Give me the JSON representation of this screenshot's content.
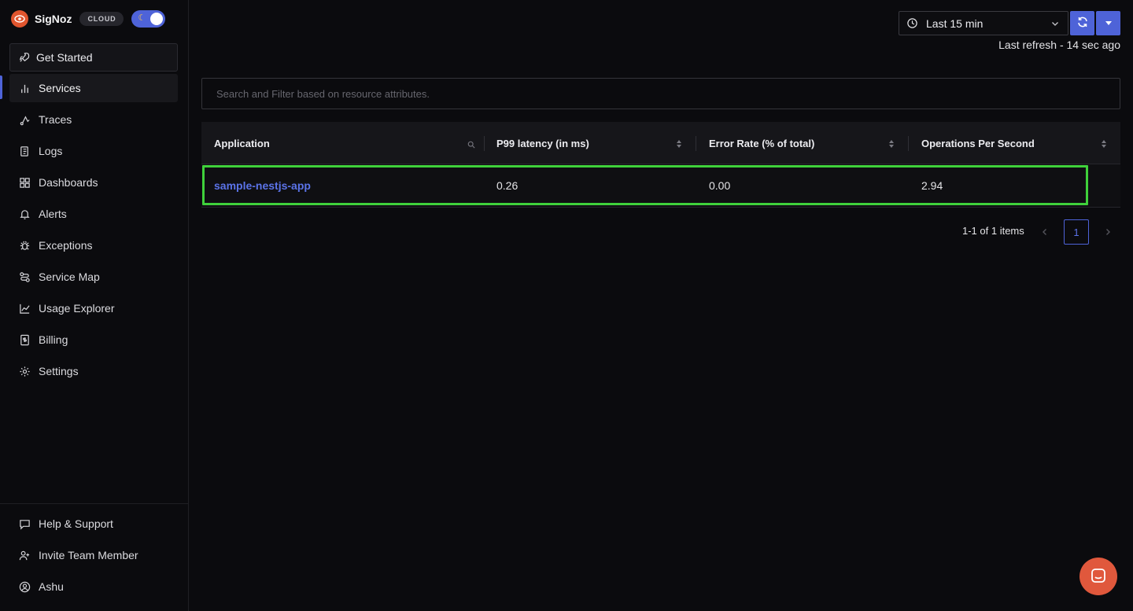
{
  "brand": {
    "name": "SigNoz",
    "badge": "CLOUD"
  },
  "sidebar": {
    "get_started": "Get Started",
    "items": [
      {
        "label": "Services",
        "icon": "bar-chart-icon",
        "active": true
      },
      {
        "label": "Traces",
        "icon": "route-icon"
      },
      {
        "label": "Logs",
        "icon": "scroll-icon"
      },
      {
        "label": "Dashboards",
        "icon": "grid-icon"
      },
      {
        "label": "Alerts",
        "icon": "bell-icon"
      },
      {
        "label": "Exceptions",
        "icon": "bug-icon"
      },
      {
        "label": "Service Map",
        "icon": "route-map-icon"
      },
      {
        "label": "Usage Explorer",
        "icon": "line-chart-icon"
      },
      {
        "label": "Billing",
        "icon": "receipt-icon"
      },
      {
        "label": "Settings",
        "icon": "gear-icon"
      }
    ],
    "footer": [
      {
        "label": "Help & Support",
        "icon": "message-icon"
      },
      {
        "label": "Invite Team Member",
        "icon": "user-plus-icon"
      },
      {
        "label": "Ashu",
        "icon": "user-circle-icon"
      }
    ]
  },
  "toolbar": {
    "time_range": "Last 15 min",
    "last_refresh": "Last refresh - 14 sec ago"
  },
  "search": {
    "placeholder": "Search and Filter based on resource attributes."
  },
  "table": {
    "columns": [
      "Application",
      "P99 latency (in ms)",
      "Error Rate (% of total)",
      "Operations Per Second"
    ],
    "rows": [
      {
        "application": "sample-nestjs-app",
        "p99": "0.26",
        "error_rate": "0.00",
        "ops": "2.94"
      }
    ]
  },
  "pagination": {
    "info": "1-1 of 1 items",
    "current_page": "1"
  },
  "colors": {
    "accent": "#4e63d8",
    "highlight": "#3fd13b",
    "brand": "#e0552e"
  }
}
